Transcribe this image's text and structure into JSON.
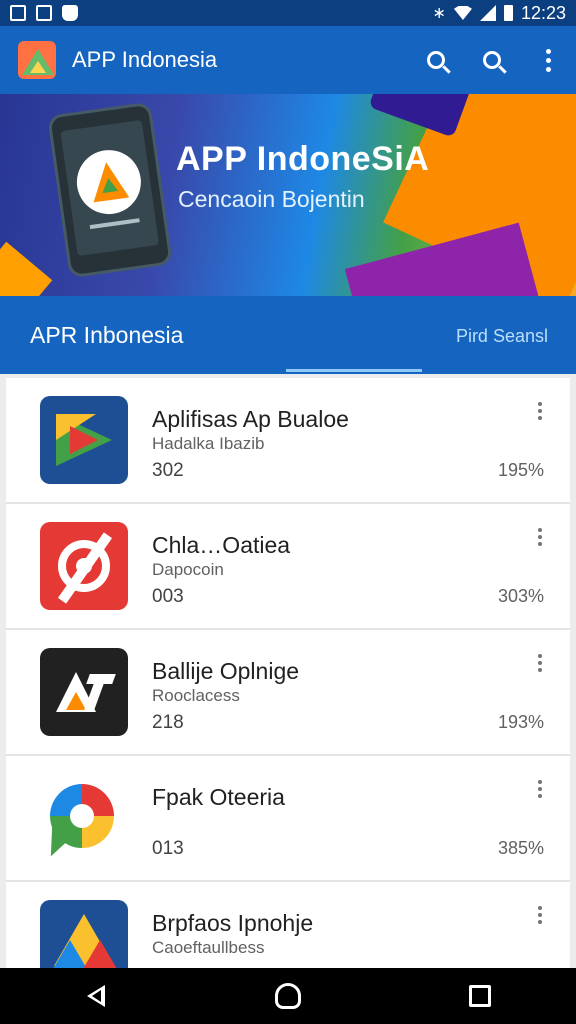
{
  "status_bar": {
    "time": "12:23",
    "icons": [
      "notification-icon",
      "image-icon",
      "shield-icon",
      "bluetooth-icon",
      "wifi-icon",
      "signal-icon",
      "battery-icon"
    ]
  },
  "app_bar": {
    "title": "APP Indonesia",
    "logo_icon": "app-logo-icon",
    "actions": [
      "search-icon",
      "search-icon",
      "more-vert-icon"
    ]
  },
  "banner": {
    "title": "APP IndoneSiA",
    "subtitle": "Cencaoin Bojentin"
  },
  "tabs": {
    "main_label": "APR Inbonesia",
    "right_label": "Pird Seansl"
  },
  "apps": [
    {
      "name": "Aplifisas Ap Bualoe",
      "subtitle": "Hadalka Ibazib",
      "value": "302",
      "percent": "195%",
      "icon": "play-store-icon"
    },
    {
      "name": "Chla…Oatiea",
      "subtitle": "Dapocoin",
      "value": "003",
      "percent": "303%",
      "icon": "red-disc-icon"
    },
    {
      "name": "Ballije Oplnige",
      "subtitle": "Rooclacess",
      "value": "218",
      "percent": "193%",
      "icon": "dark-a-icon"
    },
    {
      "name": "Fpak Oteeria",
      "subtitle": "",
      "value": "013",
      "percent": "385%",
      "icon": "map-pin-icon"
    },
    {
      "name": "Brpfaos Ipnohje",
      "subtitle": "Caoeftaullbess",
      "value": "",
      "percent": "",
      "icon": "drive-icon"
    }
  ],
  "colors": {
    "primary": "#1565c0",
    "status_bar": "#0b3f7f",
    "nav_bar": "#000000"
  }
}
